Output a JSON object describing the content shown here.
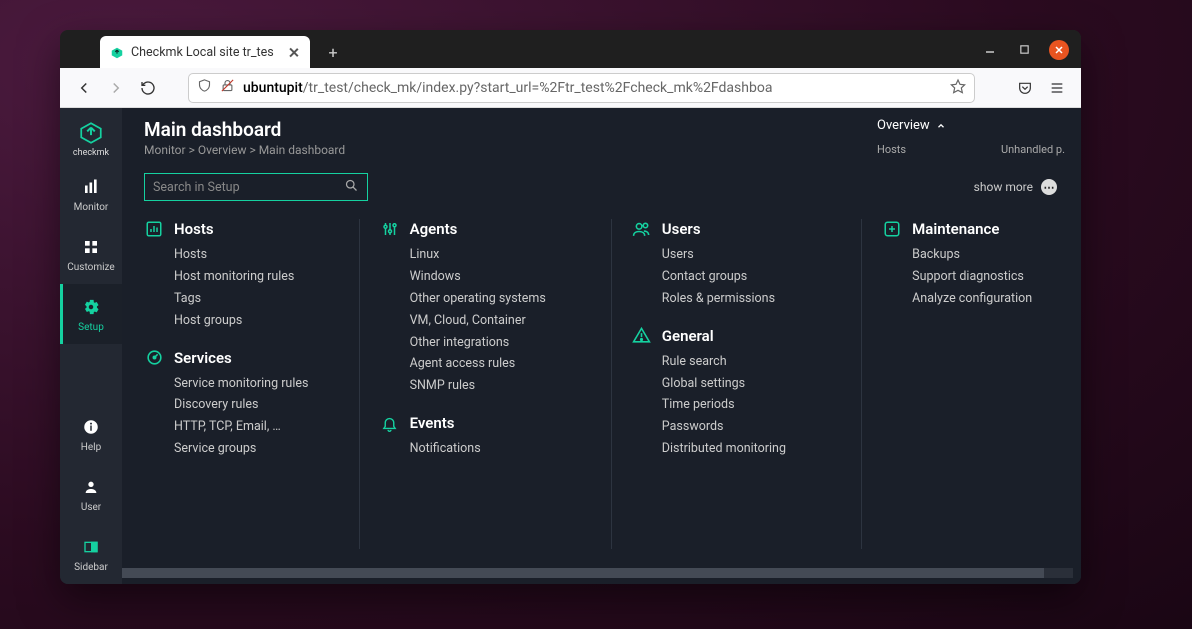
{
  "browser": {
    "tab_title": "Checkmk Local site tr_tes",
    "url_domain": "ubuntupit",
    "url_path": "/tr_test/check_mk/index.py?start_url=%2Ftr_test%2Fcheck_mk%2Fdashboa"
  },
  "sidebar": {
    "brand": "checkmk",
    "items": [
      {
        "label": "Monitor"
      },
      {
        "label": "Customize"
      },
      {
        "label": "Setup"
      }
    ],
    "bottom_items": [
      {
        "label": "Help"
      },
      {
        "label": "User"
      },
      {
        "label": "Sidebar"
      }
    ]
  },
  "header": {
    "title": "Main dashboard",
    "breadcrumbs": [
      "Monitor",
      "Overview",
      "Main dashboard"
    ]
  },
  "overview": {
    "title": "Overview",
    "col1": "Hosts",
    "col2": "Unhandled p."
  },
  "search": {
    "placeholder": "Search in Setup",
    "show_more_label": "show more"
  },
  "setup_menu": {
    "col1": [
      {
        "title": "Hosts",
        "icon": "chart",
        "links": [
          "Hosts",
          "Host monitoring rules",
          "Tags",
          "Host groups"
        ]
      },
      {
        "title": "Services",
        "icon": "gauge",
        "links": [
          "Service monitoring rules",
          "Discovery rules",
          "HTTP, TCP, Email, …",
          "Service groups"
        ]
      }
    ],
    "col2": [
      {
        "title": "Agents",
        "icon": "sliders",
        "links": [
          "Linux",
          "Windows",
          "Other operating systems",
          "VM, Cloud, Container",
          "Other integrations",
          "Agent access rules",
          "SNMP rules"
        ]
      },
      {
        "title": "Events",
        "icon": "bell",
        "links": [
          "Notifications"
        ]
      }
    ],
    "col3": [
      {
        "title": "Users",
        "icon": "users",
        "links": [
          "Users",
          "Contact groups",
          "Roles & permissions"
        ]
      },
      {
        "title": "General",
        "icon": "warning",
        "links": [
          "Rule search",
          "Global settings",
          "Time periods",
          "Passwords",
          "Distributed monitoring"
        ]
      }
    ],
    "col4": [
      {
        "title": "Maintenance",
        "icon": "plus",
        "links": [
          "Backups",
          "Support diagnostics",
          "Analyze configuration"
        ]
      }
    ]
  }
}
